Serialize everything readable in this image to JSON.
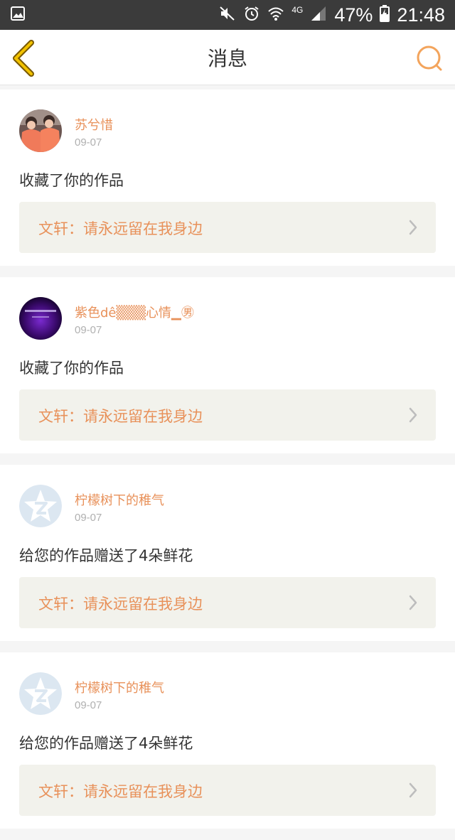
{
  "status_bar": {
    "network": "4G",
    "battery": "47%",
    "time": "21:48",
    "icons": [
      "image-icon",
      "mute-icon",
      "alarm-icon",
      "wifi-icon",
      "signal-icon",
      "battery-charging-icon"
    ]
  },
  "header": {
    "title": "消息",
    "back_icon": "back-chevron-icon",
    "search_icon": "search-icon"
  },
  "colors": {
    "accent": "#e8915a",
    "back_icon": "#f2b400",
    "search_icon": "#f3a45c",
    "card_link_bg": "#f2f2ec"
  },
  "messages": [
    {
      "user": "苏兮惜",
      "date": "09-07",
      "action": "收藏了你的作品",
      "work": "文轩：请永远留在我身边",
      "avatar": "photo-avatar"
    },
    {
      "user": "紫色dê▒▒▒心情▁㊚",
      "date": "09-07",
      "action": "收藏了你的作品",
      "work": "文轩：请永远留在我身边",
      "avatar": "purple-avatar"
    },
    {
      "user": "柠檬树下的稚气",
      "date": "09-07",
      "action": "给您的作品赠送了4朵鲜花",
      "work": "文轩：请永远留在我身边",
      "avatar": "default-avatar"
    },
    {
      "user": "柠檬树下的稚气",
      "date": "09-07",
      "action": "给您的作品赠送了4朵鲜花",
      "work": "文轩：请永远留在我身边",
      "avatar": "default-avatar"
    }
  ]
}
